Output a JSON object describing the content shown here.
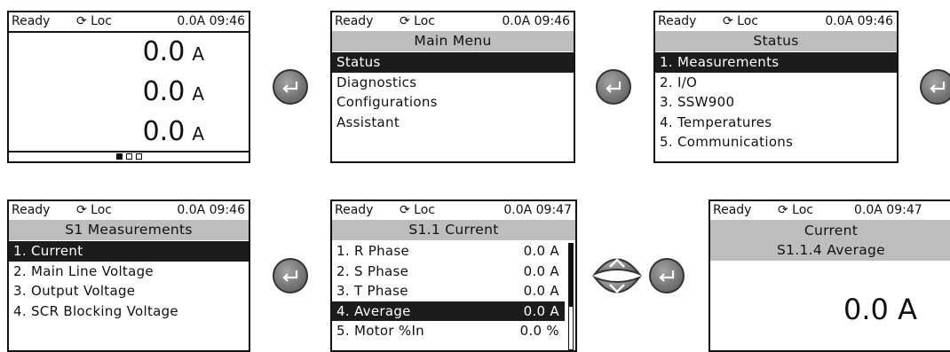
{
  "screens": [
    {
      "status": {
        "ready": "Ready",
        "loc": "⟳ Loc",
        "current": "0.0A 09:46"
      },
      "values": [
        {
          "value": "0.0",
          "unit": "A"
        },
        {
          "value": "0.0",
          "unit": "A"
        },
        {
          "value": "0.0",
          "unit": "A"
        }
      ],
      "page_indicator": {
        "pages": 3,
        "active": 1
      }
    },
    {
      "status": {
        "ready": "Ready",
        "loc": "⟳ Loc",
        "current": "0.0A 09:46"
      },
      "title": "Main Menu",
      "items": [
        {
          "label": "Status",
          "selected": true
        },
        {
          "label": "Diagnostics",
          "selected": false
        },
        {
          "label": "Configurations",
          "selected": false
        },
        {
          "label": "Assistant",
          "selected": false
        }
      ]
    },
    {
      "status": {
        "ready": "Ready",
        "loc": "⟳ Loc",
        "current": "0.0A 09:46"
      },
      "title": "Status",
      "items": [
        {
          "label": "1. Measurements",
          "selected": true
        },
        {
          "label": "2. I/O",
          "selected": false
        },
        {
          "label": "3. SSW900",
          "selected": false
        },
        {
          "label": "4. Temperatures",
          "selected": false
        },
        {
          "label": "5. Communications",
          "selected": false
        }
      ]
    },
    {
      "status": {
        "ready": "Ready",
        "loc": "⟳ Loc",
        "current": "0.0A 09:46"
      },
      "title": "S1 Measurements",
      "items": [
        {
          "label": "1. Current",
          "selected": true
        },
        {
          "label": "2. Main Line Voltage",
          "selected": false
        },
        {
          "label": "3. Output Voltage",
          "selected": false
        },
        {
          "label": "4. SCR Blocking Voltage",
          "selected": false
        }
      ]
    },
    {
      "status": {
        "ready": "Ready",
        "loc": "⟳ Loc",
        "current": "0.0A 09:47"
      },
      "title": "S1.1 Current",
      "items": [
        {
          "label": "1. R Phase",
          "value": "0.0 A",
          "selected": false
        },
        {
          "label": "2. S Phase",
          "value": "0.0 A",
          "selected": false
        },
        {
          "label": "3. T Phase",
          "value": "0.0 A",
          "selected": false
        },
        {
          "label": "4. Average",
          "value": "0.0 A",
          "selected": true
        },
        {
          "label": "5. Motor %In",
          "value": "0.0 %",
          "selected": false
        }
      ]
    },
    {
      "status": {
        "ready": "Ready",
        "loc": "⟳ Loc",
        "current": "0.0A 09:47"
      },
      "title": "Current",
      "subtitle": "S1.1.4 Average",
      "big_value": "0.0 A"
    }
  ],
  "colors": {
    "selected_bg": "#1c1c1c",
    "title_bg": "#bdbdbd",
    "button": "#777777"
  },
  "icons": {
    "enter": "enter-icon",
    "updown": "up-down-arrows-icon"
  }
}
